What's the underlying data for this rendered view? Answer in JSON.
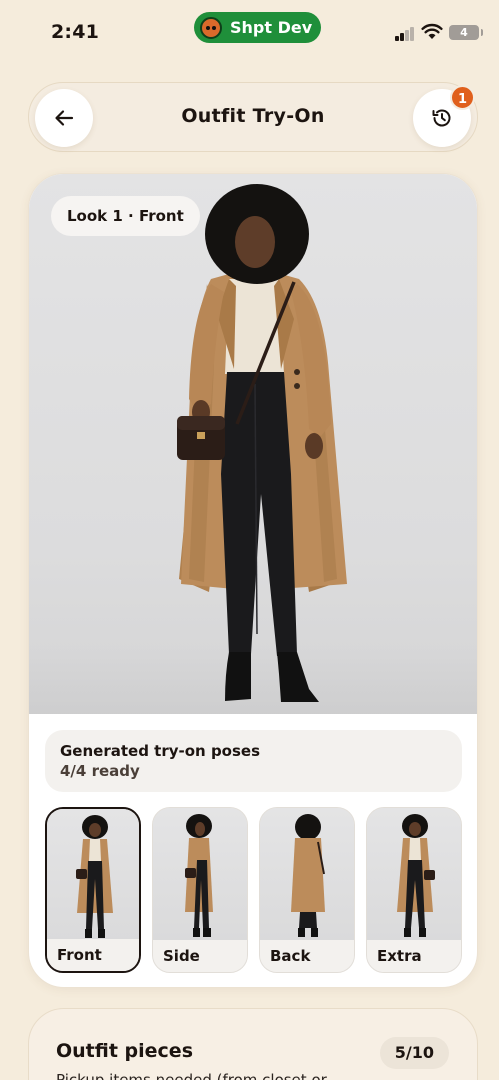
{
  "status_bar": {
    "time": "2:41",
    "dev_label": "Shpt Dev",
    "battery": "4"
  },
  "header": {
    "title": "Outfit Try-On",
    "history_badge": "1"
  },
  "hero": {
    "look_label": "Look 1 · Front"
  },
  "poses": {
    "title": "Generated try-on poses",
    "status": "4/4 ready",
    "thumbnails": [
      {
        "label": "Front"
      },
      {
        "label": "Side"
      },
      {
        "label": "Back"
      },
      {
        "label": "Extra"
      }
    ],
    "selected": "Front"
  },
  "pieces": {
    "title": "Outfit pieces",
    "count": "5/10",
    "description": "Pickup items needed (from closet or"
  },
  "colors": {
    "accent": "#e0601c",
    "dev_pill": "#1f8f3a",
    "background": "#f5ecdc",
    "coat": "#b8895a",
    "pants": "#1a1a1c"
  }
}
